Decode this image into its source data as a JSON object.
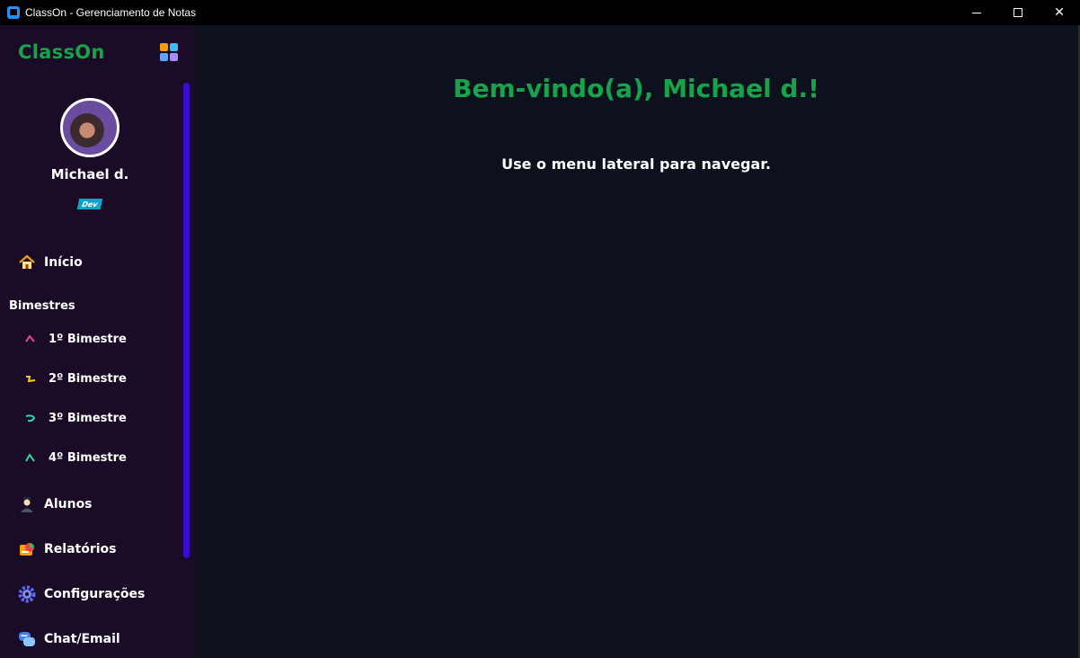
{
  "window": {
    "title": "ClassOn - Gerenciamento de Notas",
    "controls": {
      "minimize": "minimize-icon",
      "maximize": "maximize-icon",
      "close": "✕"
    }
  },
  "sidebar": {
    "brand": "ClassOn",
    "brand_color": "#16a34a",
    "user": {
      "name": "Michael d.",
      "role_badge": "Dev"
    },
    "home": {
      "label": "Início",
      "icon": "house-icon"
    },
    "section_label": "Bimestres",
    "bimesters": [
      {
        "label": "1º Bimestre",
        "icon": "pink-squiggle-icon"
      },
      {
        "label": "2º Bimestre",
        "icon": "yellow-squiggle-icon"
      },
      {
        "label": "3º Bimestre",
        "icon": "teal-squiggle-icon"
      },
      {
        "label": "4º Bimestre",
        "icon": "green-squiggle-icon"
      }
    ],
    "items": [
      {
        "label": "Alunos",
        "icon": "student-icon"
      },
      {
        "label": "Relatórios",
        "icon": "report-icon"
      },
      {
        "label": "Configurações",
        "icon": "gear-icon"
      },
      {
        "label": "Chat/Email",
        "icon": "chat-icon"
      }
    ]
  },
  "main": {
    "welcome": "Bem-vindo(a), Michael d.!",
    "hint": "Use o menu lateral para navegar."
  }
}
